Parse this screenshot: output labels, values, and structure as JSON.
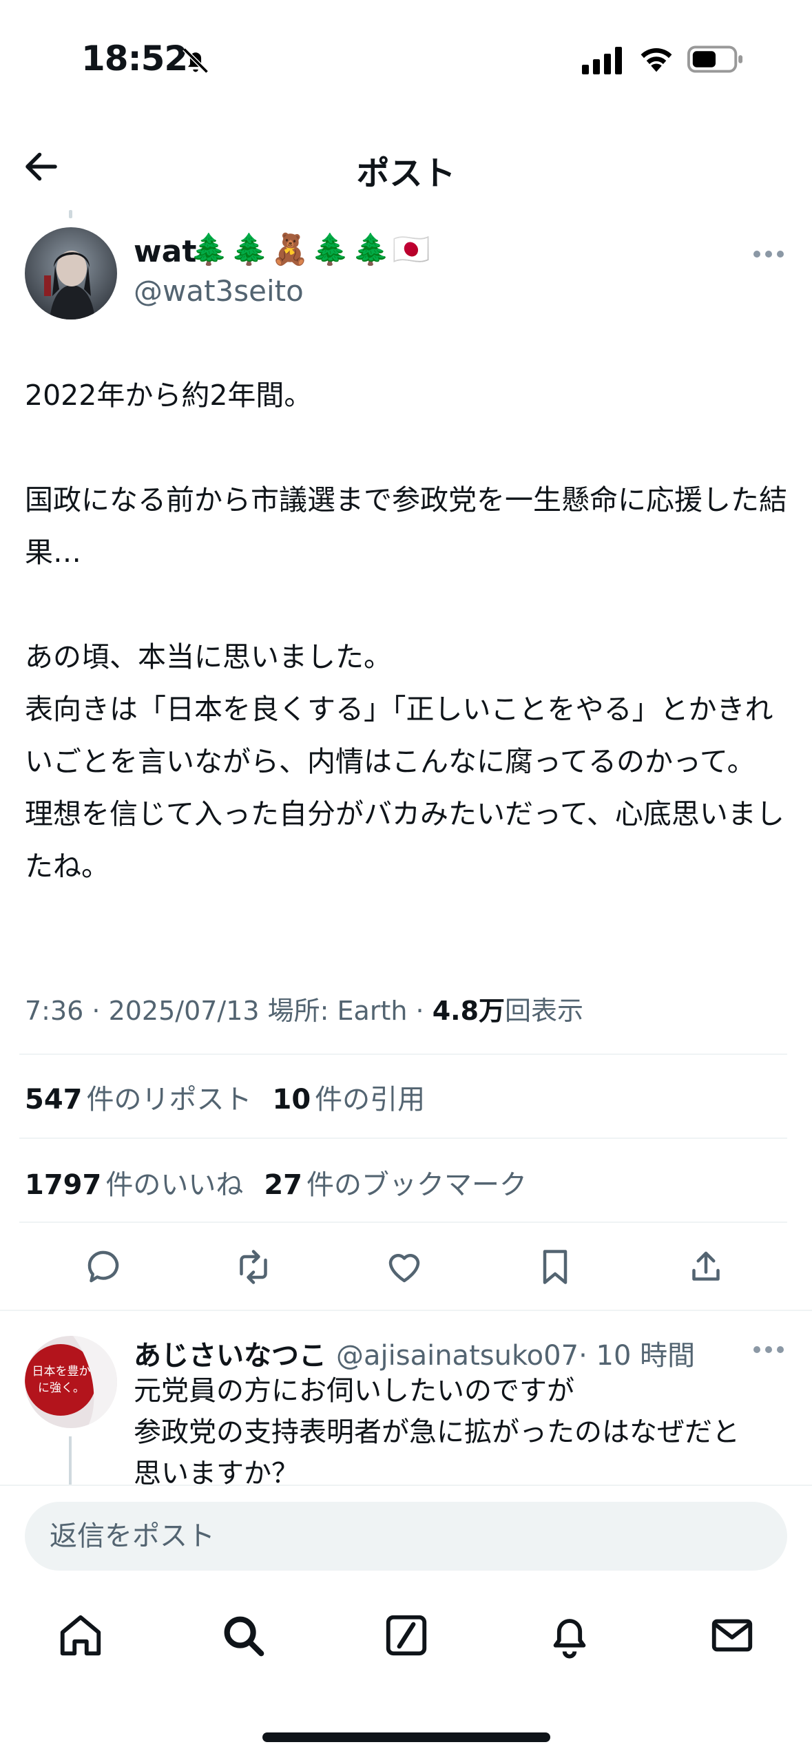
{
  "status_bar": {
    "time": "18:52"
  },
  "header": {
    "title": "ポスト"
  },
  "post": {
    "author_name": "wat",
    "author_emoji": "🌲🌲🧸🌲🌲🇯🇵",
    "author_handle": "@wat3seito",
    "paragraphs": [
      "2022年から約2年間。",
      "国政になる前から市議選まで参政党を一生懸命に応援した結果…",
      "あの頃、本当に思いました。\n表向きは「日本を良くする」「正しいことをやる」とかきれいごとを言いながら、内情はこんなに腐ってるのかって。\n理想を信じて入った自分がバカみたいだって、心底思いましたね。"
    ],
    "meta_time": "7:36 · 2025/07/13 場所: Earth ·",
    "views_value": "4.8万",
    "views_label": "回表示",
    "stats": {
      "reposts_value": "547",
      "reposts_label": "件のリポスト",
      "quotes_value": "10",
      "quotes_label": "件の引用",
      "likes_value": "1797",
      "likes_label": "件のいいね",
      "bookmarks_value": "27",
      "bookmarks_label": "件のブックマーク"
    }
  },
  "reply": {
    "avatar_text": "日本を豊かに強く。",
    "name": "あじさいなつこ",
    "handle": "@ajisainatsuko07",
    "time": "· 10 時間",
    "lines": [
      "元党員の方にお伺いしたいのですが",
      "参政党の支持表明者が急に拡がったのはなぜだと",
      "思いますか？"
    ]
  },
  "composer": {
    "placeholder": "返信をポスト"
  },
  "icons": {
    "back": "arrow-left-icon",
    "more": "ellipsis-icon",
    "actions": [
      "reply-icon",
      "repost-icon",
      "like-icon",
      "bookmark-icon",
      "share-icon"
    ],
    "tabs": [
      "home-icon",
      "search-icon",
      "grok-icon",
      "notifications-icon",
      "messages-icon"
    ]
  },
  "colors": {
    "text": "#0f1419",
    "secondary": "#536471",
    "divider": "#eff3f4"
  }
}
